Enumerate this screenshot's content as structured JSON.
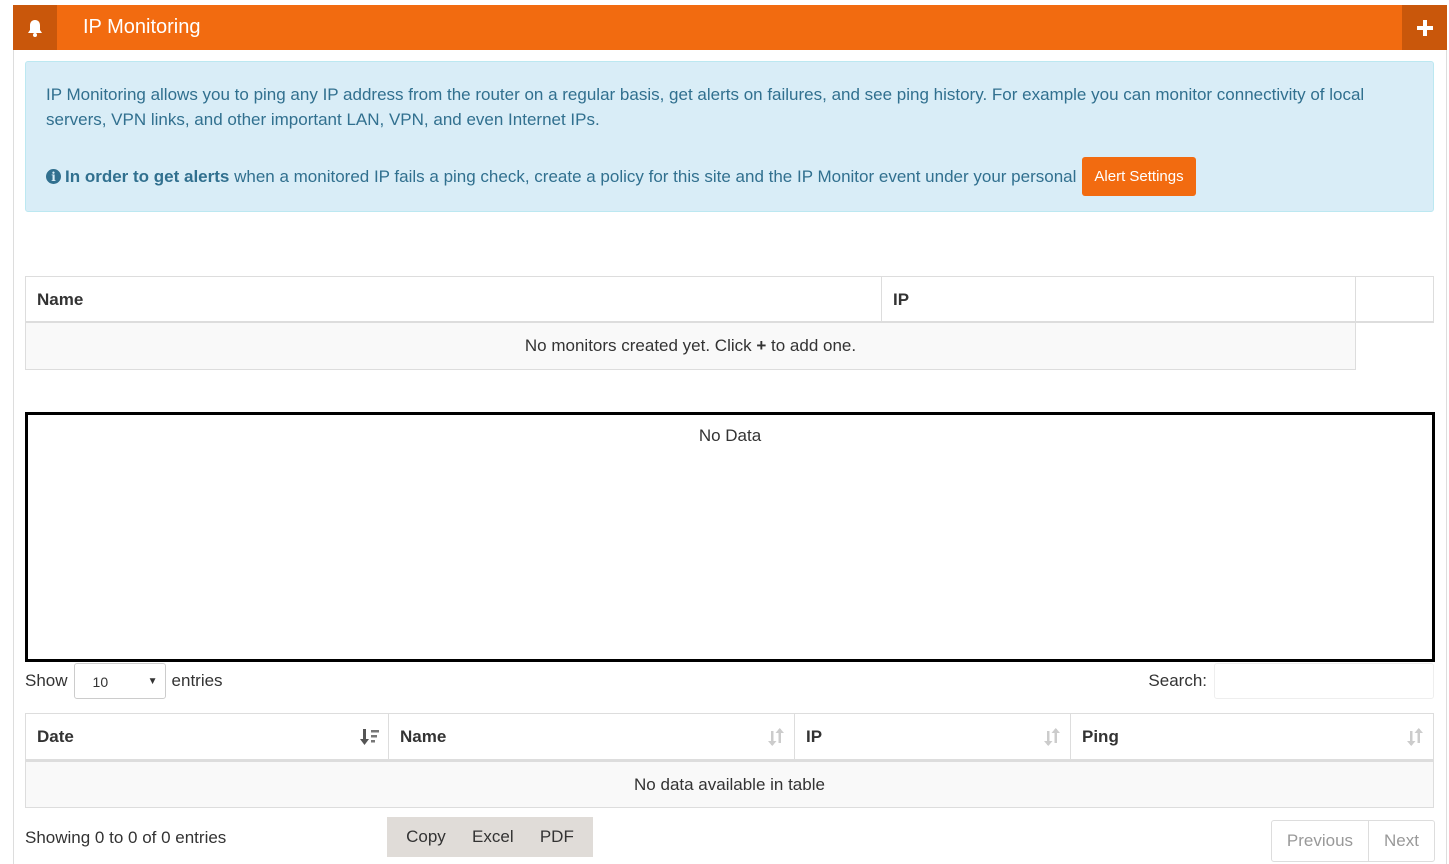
{
  "header": {
    "title": "IP Monitoring",
    "bell_icon": "bell-icon",
    "add_icon": "plus-icon",
    "accent": "#f26b10"
  },
  "info": {
    "description": "IP Monitoring allows you to ping any IP address from the router on a regular basis, get alerts on failures, and see ping history. For example you can monitor connectivity of local servers, VPN links, and other important LAN, VPN, and even Internet IPs.",
    "alert_bold": "In order to get alerts",
    "alert_text": " when a monitored IP fails a ping check, create a policy for this site and the IP Monitor event under your personal",
    "alert_button": "Alert Settings"
  },
  "monitors_table": {
    "columns": [
      "Name",
      "IP",
      ""
    ],
    "empty_prefix": "No monitors created yet. Click ",
    "empty_plus": "+",
    "empty_suffix": " to add one."
  },
  "chart": {
    "empty_text": "No Data"
  },
  "length_control": {
    "show_label": "Show",
    "value": "10",
    "entries_label": "entries"
  },
  "search": {
    "label": "Search:",
    "value": ""
  },
  "history_table": {
    "columns": [
      "Date",
      "Name",
      "IP",
      "Ping"
    ],
    "empty_text": "No data available in table"
  },
  "footer": {
    "info": "Showing 0 to 0 of 0 entries",
    "buttons": [
      "Copy",
      "Excel",
      "PDF"
    ],
    "previous": "Previous",
    "next": "Next"
  }
}
